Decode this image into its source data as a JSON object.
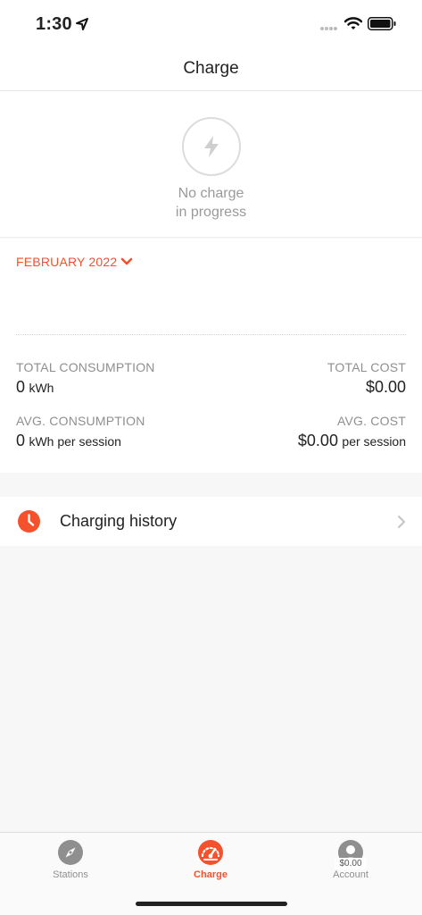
{
  "status_bar": {
    "time": "1:30"
  },
  "nav": {
    "title": "Charge"
  },
  "charge_status": {
    "line1": "No charge",
    "line2": "in progress"
  },
  "stats": {
    "month": "FEBRUARY 2022",
    "total_consumption": {
      "label": "TOTAL CONSUMPTION",
      "value": "0",
      "unit": "kWh"
    },
    "total_cost": {
      "label": "TOTAL COST",
      "value": "$0.00"
    },
    "avg_consumption": {
      "label": "AVG. CONSUMPTION",
      "value": "0",
      "unit": "kWh per session"
    },
    "avg_cost": {
      "label": "AVG. COST",
      "value": "$0.00",
      "unit": "per session"
    }
  },
  "history": {
    "label": "Charging history"
  },
  "tabs": [
    {
      "label": "Stations",
      "icon": "compass-icon",
      "active": false
    },
    {
      "label": "Charge",
      "icon": "speedometer-icon",
      "active": true
    },
    {
      "label": "Account",
      "icon": "avatar-icon",
      "active": false,
      "badge": "$0.00"
    }
  ],
  "colors": {
    "accent": "#f4512c",
    "inactive": "#8f8f8f"
  }
}
